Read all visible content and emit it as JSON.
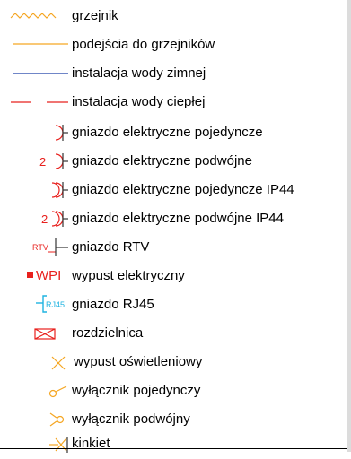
{
  "legend": {
    "items": [
      {
        "label": "grzejnik",
        "icon": "radiator-zigzag-icon"
      },
      {
        "label": "podejścia do grzejników",
        "icon": "radiator-connection-line-icon"
      },
      {
        "label": "instalacja wody zimnej",
        "icon": "cold-water-line-icon"
      },
      {
        "label": "instalacja wody ciepłej",
        "icon": "hot-water-dashed-line-icon"
      },
      {
        "label": "gniazdo elektryczne pojedyncze",
        "icon": "single-socket-icon"
      },
      {
        "label": "gniazdo elektryczne podwójne",
        "icon": "double-socket-icon",
        "marker": "2"
      },
      {
        "label": "gniazdo elektryczne pojedyncze IP44",
        "icon": "single-socket-ip44-icon"
      },
      {
        "label": "gniazdo elektryczne podwójne IP44",
        "icon": "double-socket-ip44-icon",
        "marker": "2"
      },
      {
        "label": "gniazdo RTV",
        "icon": "tv-socket-icon",
        "marker": "RTV"
      },
      {
        "label": "wypust elektryczny",
        "icon": "electrical-outlet-point-icon",
        "marker": "WPI"
      },
      {
        "label": "gniazdo RJ45",
        "icon": "rj45-socket-icon",
        "marker": "RJ45"
      },
      {
        "label": "rozdzielnica",
        "icon": "distribution-board-icon"
      },
      {
        "label": "wypust oświetleniowy",
        "icon": "lighting-outlet-icon"
      },
      {
        "label": "wyłącznik pojedynczy",
        "icon": "single-switch-icon"
      },
      {
        "label": "wyłącznik podwójny",
        "icon": "double-switch-icon"
      },
      {
        "label": "kinkiet",
        "icon": "wall-lamp-icon"
      }
    ]
  },
  "colors": {
    "heating": "#f5a623",
    "cold_water": "#1a3fa8",
    "electrical": "#e8201d",
    "rj45": "#1fb3e0",
    "frame": "#000000"
  }
}
